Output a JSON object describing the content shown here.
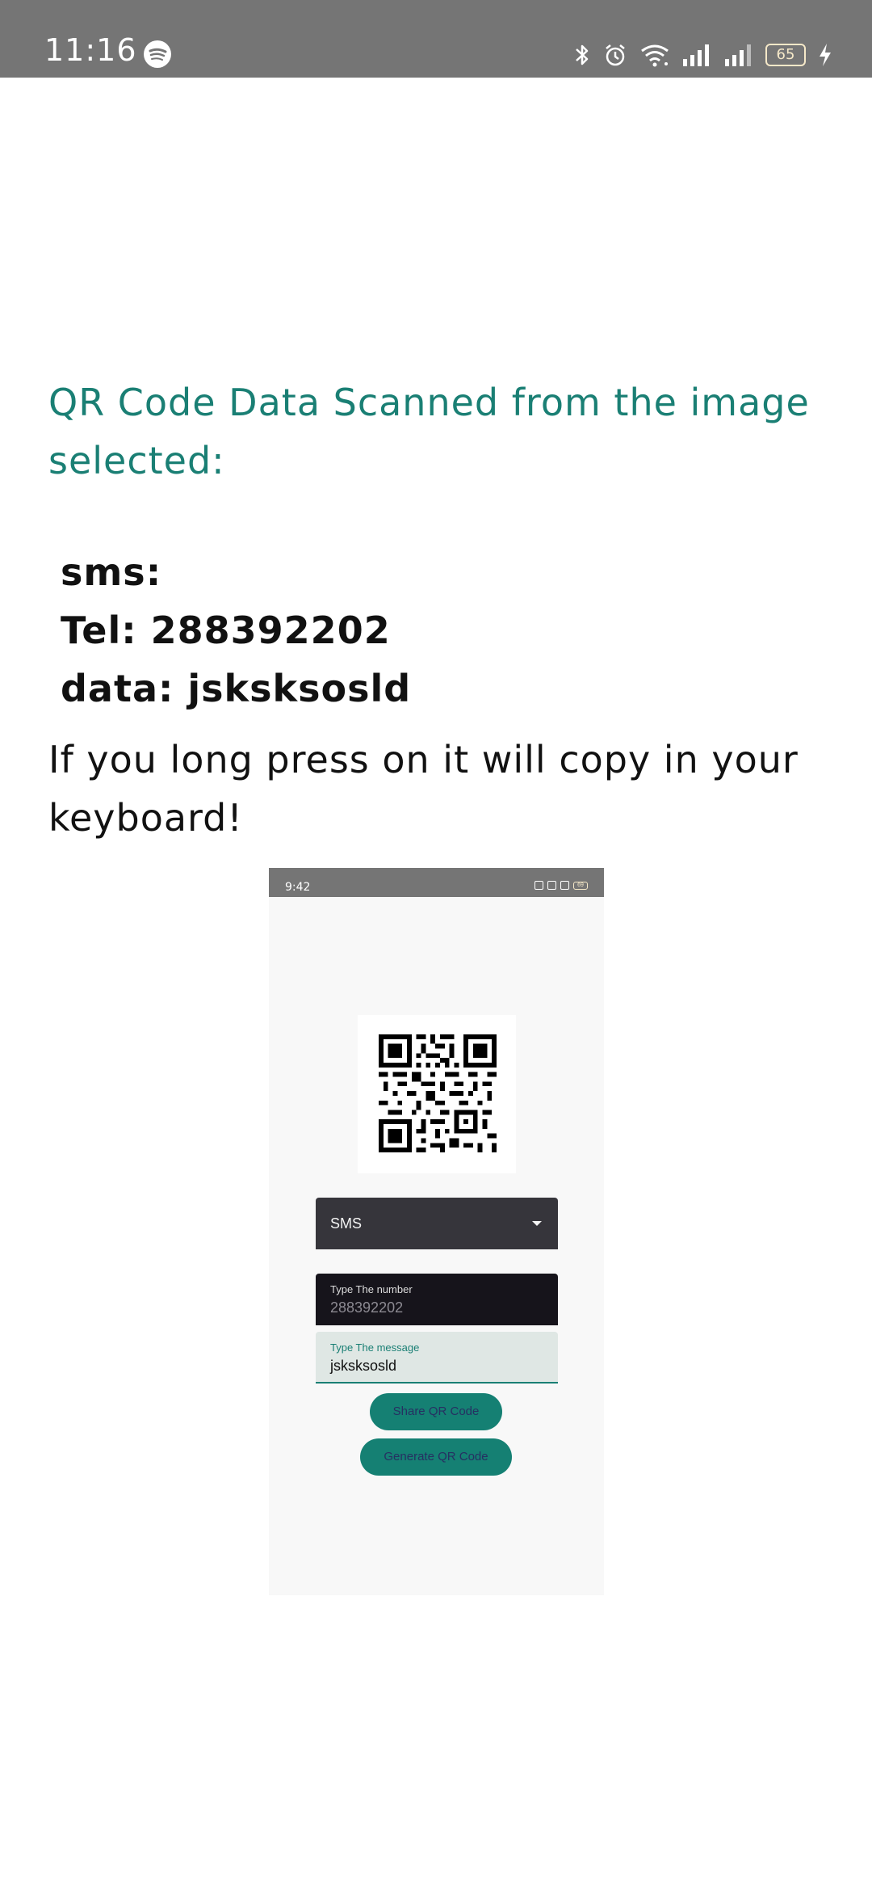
{
  "status_bar": {
    "time": "11:16",
    "battery": "65",
    "icons": [
      "spotify-icon",
      "bluetooth-icon",
      "alarm-icon",
      "wifi-icon",
      "signal-icon",
      "signal-icon-2",
      "battery-icon",
      "charging-icon"
    ]
  },
  "main": {
    "title": "QR Code Data Scanned from the image selected:",
    "scanned_text": "sms:\nTel: 288392202\ndata: jsksksosld",
    "hint": "If you long press on it will copy in your keyboard!"
  },
  "embedded_screenshot": {
    "status_time": "9:42",
    "status_battery": "69",
    "spinner_selected": "SMS",
    "number_field": {
      "label": "Type The number",
      "value": "288392202"
    },
    "message_field": {
      "label": "Type The message",
      "value": "jsksksosld"
    },
    "share_button": "Share QR Code",
    "generate_button": "Generate QR Code"
  },
  "colors": {
    "accent": "#1a7f74",
    "status_bar": "#757575",
    "button": "#158073"
  }
}
